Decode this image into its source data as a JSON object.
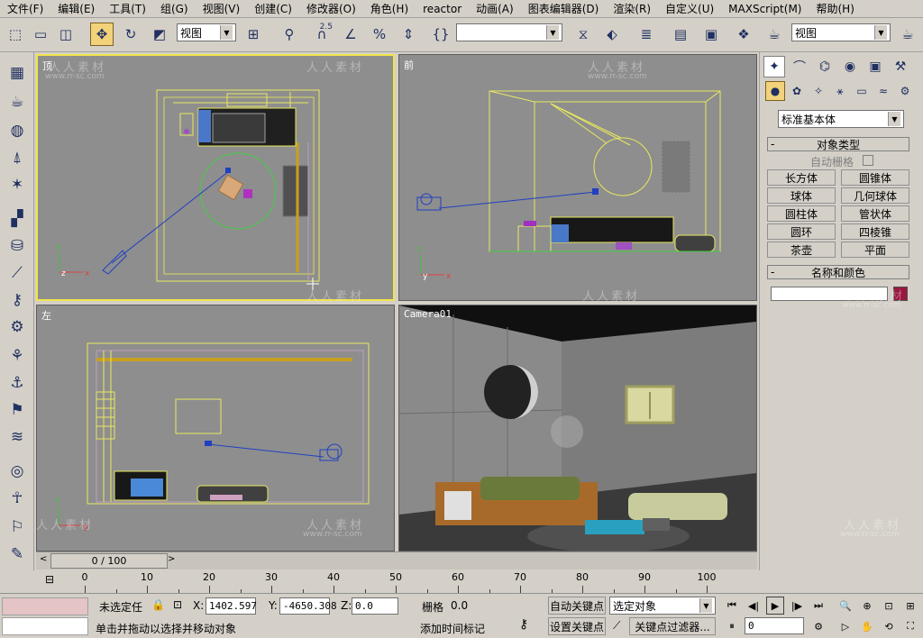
{
  "menu": [
    "文件(F)",
    "编辑(E)",
    "工具(T)",
    "组(G)",
    "视图(V)",
    "创建(C)",
    "修改器(O)",
    "角色(H)",
    "reactor",
    "动画(A)",
    "图表编辑器(D)",
    "渲染(R)",
    "自定义(U)",
    "MAXScript(M)",
    "帮助(H)"
  ],
  "toolbar": {
    "ref_coord_value": "视图",
    "named_sel_value": "视图",
    "snap_label": "2.5"
  },
  "viewports": {
    "top": "顶",
    "front": "前",
    "left": "左",
    "camera": "Camera01"
  },
  "command_panel": {
    "category_value": "标准基本体",
    "object_type_title": "对象类型",
    "auto_grid_label": "自动栅格",
    "primitives": [
      "长方体",
      "圆锥体",
      "球体",
      "几何球体",
      "圆柱体",
      "管状体",
      "圆环",
      "四棱锥",
      "茶壶",
      "平面"
    ],
    "name_color_title": "名称和颜色",
    "object_color": "#9a1840"
  },
  "timeline": {
    "frame_display": "0 / 100",
    "ticks": [
      "0",
      "10",
      "20",
      "30",
      "40",
      "50",
      "60",
      "70",
      "80",
      "90",
      "100"
    ]
  },
  "status": {
    "selection_text": "未选定任",
    "x_label": "X:",
    "x_value": "1402.597",
    "y_label": "Y:",
    "y_value": "-4650.308",
    "z_label": "Z:",
    "z_value": "0.0",
    "grid_label": "栅格",
    "grid_value": "0.0",
    "auto_key_label": "自动关键点",
    "selected_object_value": "选定对象",
    "set_key_label": "设置关键点",
    "key_filters_label": "关键点过滤器...",
    "prompt_text": "单击并拖动以选择并移动对象",
    "add_time_tag_label": "添加时间标记",
    "current_frame": "0"
  },
  "watermark": {
    "text": "人人素材",
    "url": "www.rr-sc.com"
  },
  "colors": {
    "viewport_bg": "#8e8e8e",
    "active_border": "#f0e44a",
    "wireframe_yellow": "#e8e860",
    "camera_blue": "#2040c0"
  }
}
